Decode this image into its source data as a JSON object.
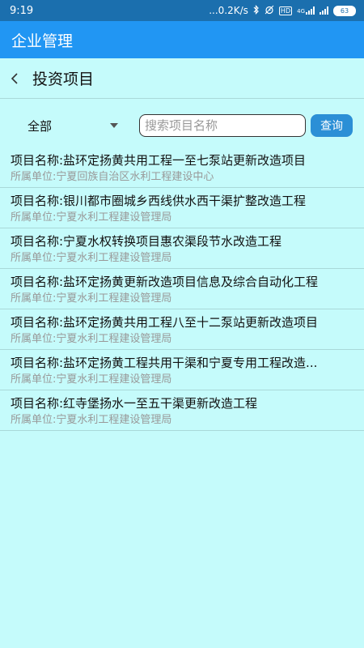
{
  "status_bar": {
    "time": "9:19",
    "network_speed": "...0.2K/s",
    "bluetooth_icon": "bluetooth-icon",
    "alarm_icon": "alarm-icon",
    "hd_badge": "HD",
    "signal_label": "4G",
    "battery": "63"
  },
  "app_bar": {
    "title": "企业管理"
  },
  "sub_header": {
    "title": "投资项目"
  },
  "filter": {
    "dropdown_value": "全部",
    "search_placeholder": "搜索项目名称",
    "query_label": "查询"
  },
  "projects": [
    {
      "name": "项目名称:盐环定扬黄共用工程一至七泵站更新改造项目",
      "unit": "所属单位:宁夏回族自治区水利工程建设中心"
    },
    {
      "name": "项目名称:银川都市圈城乡西线供水西干渠扩整改造工程",
      "unit": "所属单位:宁夏水利工程建设管理局"
    },
    {
      "name": "项目名称:宁夏水权转换项目惠农渠段节水改造工程",
      "unit": "所属单位:宁夏水利工程建设管理局"
    },
    {
      "name": "项目名称:盐环定扬黄更新改造项目信息及综合自动化工程",
      "unit": "所属单位:宁夏水利工程建设管理局"
    },
    {
      "name": "项目名称:盐环定扬黄共用工程八至十二泵站更新改造项目",
      "unit": "所属单位:宁夏水利工程建设管理局"
    },
    {
      "name": "项目名称:盐环定扬黄工程共用干渠和宁夏专用工程改造...",
      "unit": "所属单位:宁夏水利工程建设管理局"
    },
    {
      "name": "项目名称:红寺堡扬水一至五干渠更新改造工程",
      "unit": "所属单位:宁夏水利工程建设管理局"
    }
  ]
}
